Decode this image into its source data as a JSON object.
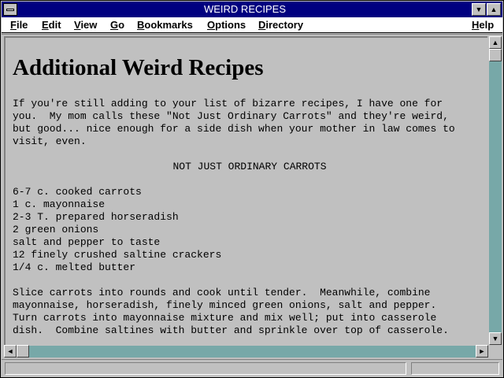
{
  "window": {
    "title": "WEIRD RECIPES"
  },
  "titlebar_buttons": {
    "minimize_glyph": "▼",
    "maximize_glyph": "▲"
  },
  "menu": {
    "file": {
      "hot": "F",
      "rest": "ile"
    },
    "edit": {
      "hot": "E",
      "rest": "dit"
    },
    "view": {
      "hot": "V",
      "rest": "iew"
    },
    "go": {
      "hot": "G",
      "rest": "o"
    },
    "bookmarks": {
      "hot": "B",
      "rest": "ookmarks"
    },
    "options": {
      "hot": "O",
      "rest": "ptions"
    },
    "directory": {
      "hot": "D",
      "rest": "irectory"
    },
    "help": {
      "hot": "H",
      "rest": "elp"
    }
  },
  "document": {
    "heading": "Additional Weird Recipes",
    "intro": "If you're still adding to your list of bizarre recipes, I have one for\nyou.  My mom calls these \"Not Just Ordinary Carrots\" and they're weird,\nbut good... nice enough for a side dish when your mother in law comes to\nvisit, even.",
    "recipe_title": "NOT JUST ORDINARY CARROTS",
    "ingredients": [
      "6-7 c. cooked carrots",
      "1 c. mayonnaise",
      "2-3 T. prepared horseradish",
      "2 green onions",
      "salt and pepper to taste",
      "12 finely crushed saltine crackers",
      "1/4 c. melted butter"
    ],
    "directions": "Slice carrots into rounds and cook until tender.  Meanwhile, combine\nmayonnaise, horseradish, finely minced green onions, salt and pepper.\nTurn carrots into mayonnaise mixture and mix well; put into casserole\ndish.  Combine saltines with butter and sprinkle over top of casserole."
  },
  "scrollbar": {
    "up": "▲",
    "down": "▼",
    "left": "◄",
    "right": "►",
    "vertical_position": 0.0,
    "horizontal_position": 0.0
  },
  "status": {
    "message": "",
    "progress": ""
  }
}
